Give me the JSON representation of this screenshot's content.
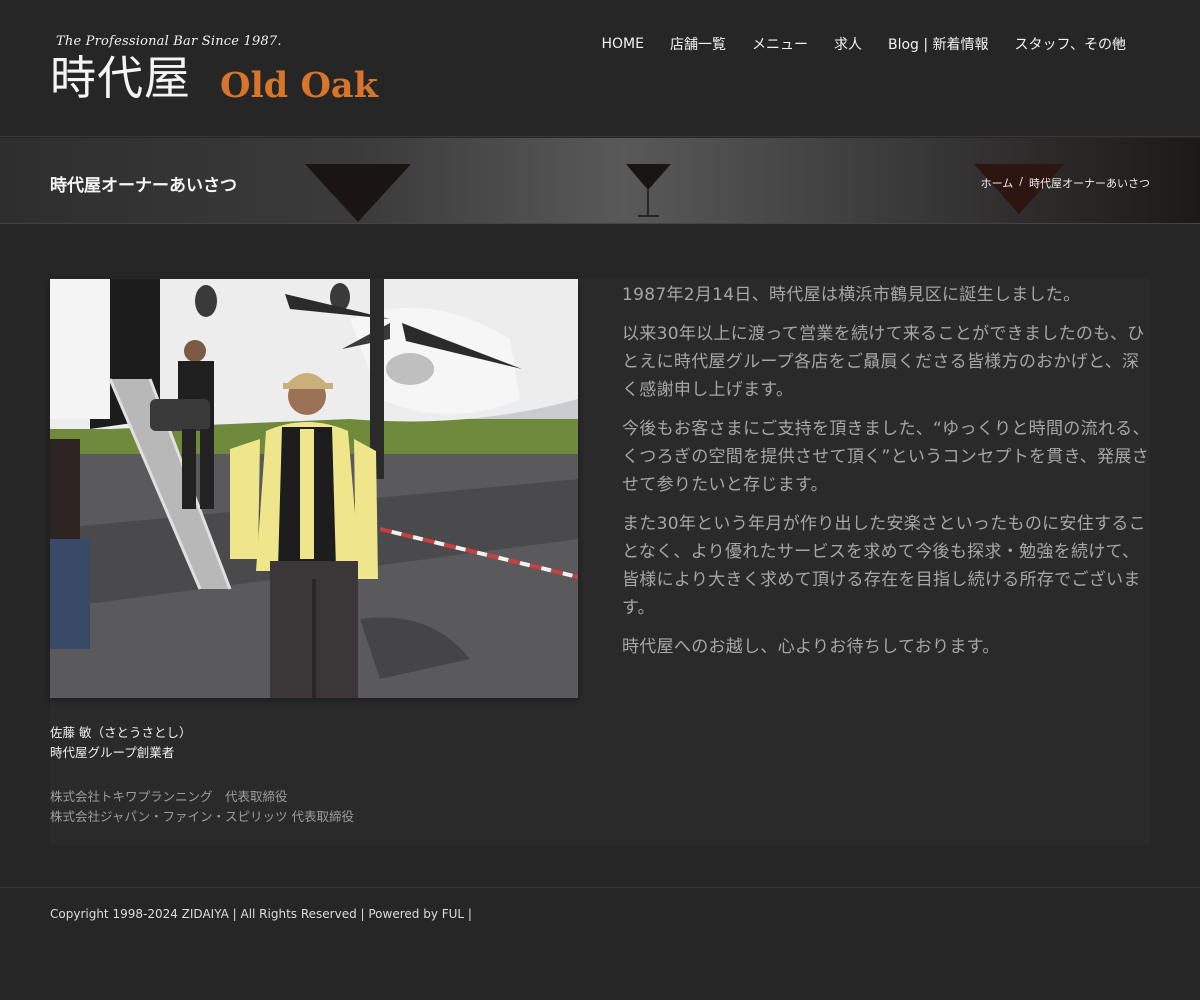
{
  "logo": {
    "tagline": "The Professional Bar Since 1987.",
    "kanji": "時代屋",
    "english": "Old Oak"
  },
  "nav": {
    "items": [
      "HOME",
      "店舗一覧",
      "メニュー",
      "求人",
      "Blog | 新着情報",
      "スタッフ、その他"
    ],
    "lang_icon": "88"
  },
  "titlebar": {
    "title": "時代屋オーナーあいさつ",
    "breadcrumb": {
      "home": "ホーム",
      "separator": "/",
      "current": "時代屋オーナーあいさつ"
    }
  },
  "profile": {
    "photo_icon": "owner-photo",
    "name": "佐藤 敏（さとうさとし）",
    "role": "時代屋グループ創業者",
    "positions": [
      "株式会社トキワプランニング　代表取締役",
      "株式会社ジャパン・ファイン・スピリッツ 代表取締役"
    ]
  },
  "message": {
    "paragraphs": [
      "1987年2月14日、時代屋は横浜市鶴見区に誕生しました。",
      "以来30年以上に渡って営業を続けて来ることができましたのも、ひとえに時代屋グループ各店をご贔屓くださる皆様方のおかげと、深く感謝申し上げます。",
      "今後もお客さまにご支持を頂きました、“ゆっくりと時間の流れる、くつろぎの空間を提供させて頂く”というコンセプトを貫き、発展させて参りたいと存じます。",
      "また30年という年月が作り出した安楽さといったものに安住することなく、より優れたサービスを求めて今後も探求・勉強を続けて、皆様により大きく求めて頂ける存在を目指し続ける所存でございます。",
      "時代屋へのお越し、心よりお待ちしております。"
    ]
  },
  "footer": {
    "copyright": "Copyright 1998-2024 ZIDAIYA | All Rights Reserved | Powered by FUL |"
  },
  "colors": {
    "background": "#262626",
    "accent": "#d8752c",
    "text_muted": "#a6a6a6"
  }
}
